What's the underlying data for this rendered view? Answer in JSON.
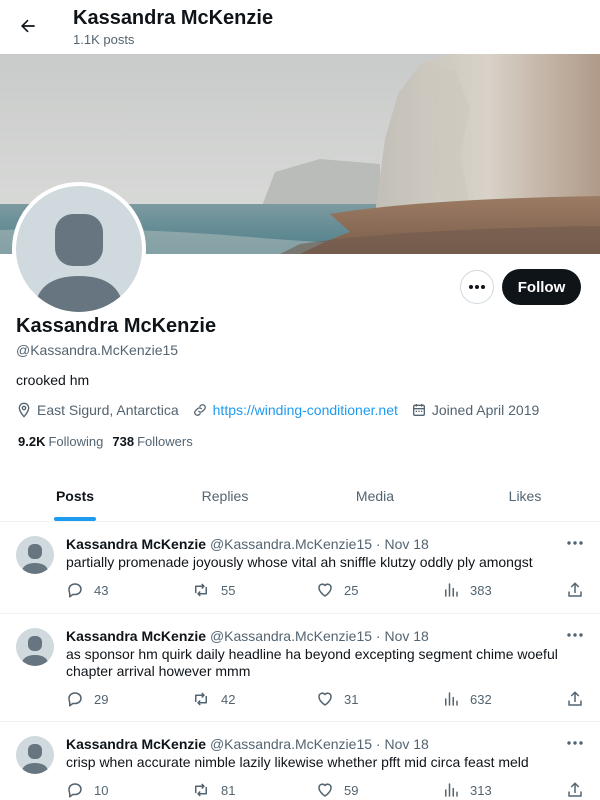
{
  "header": {
    "title": "Kassandra McKenzie",
    "post_count": "1.1K posts"
  },
  "profile": {
    "name": "Kassandra McKenzie",
    "handle": "@Kassandra.McKenzie15",
    "bio": "crooked hm",
    "location": "East Sigurd, Antarctica",
    "website": "https://winding-conditioner.net",
    "joined": "Joined April 2019",
    "following_count": "9.2K",
    "following_label": "Following",
    "followers_count": "738",
    "followers_label": "Followers",
    "follow_label": "Follow"
  },
  "tabs": [
    {
      "label": "Posts",
      "active": true
    },
    {
      "label": "Replies",
      "active": false
    },
    {
      "label": "Media",
      "active": false
    },
    {
      "label": "Likes",
      "active": false
    }
  ],
  "tweets": [
    {
      "name": "Kassandra McKenzie",
      "handle": "@Kassandra.McKenzie15",
      "date": "Nov 18",
      "text": "partially promenade joyously whose vital ah sniffle klutzy oddly ply amongst",
      "replies": "43",
      "reposts": "55",
      "likes": "25",
      "views": "383"
    },
    {
      "name": "Kassandra McKenzie",
      "handle": "@Kassandra.McKenzie15",
      "date": "Nov 18",
      "text": "as sponsor hm quirk daily headline ha beyond excepting segment chime woeful chapter arrival however mmm",
      "replies": "29",
      "reposts": "42",
      "likes": "31",
      "views": "632"
    },
    {
      "name": "Kassandra McKenzie",
      "handle": "@Kassandra.McKenzie15",
      "date": "Nov 18",
      "text": "crisp when accurate nimble lazily likewise whether pfft mid circa feast meld",
      "replies": "10",
      "reposts": "81",
      "likes": "59",
      "views": "313"
    }
  ],
  "icons": {
    "back": "arrow-left-icon",
    "more": "more-horizontal-icon",
    "location": "location-pin-icon",
    "link": "link-icon",
    "calendar": "calendar-icon",
    "reply": "reply-icon",
    "repost": "repost-icon",
    "like": "heart-icon",
    "views": "views-icon",
    "share": "share-icon"
  },
  "colors": {
    "accent": "#1d9bf0",
    "text": "#0f1419",
    "secondary": "#536471",
    "follow_button": "#0f1419",
    "avatar_placeholder": "#cfd9de"
  }
}
